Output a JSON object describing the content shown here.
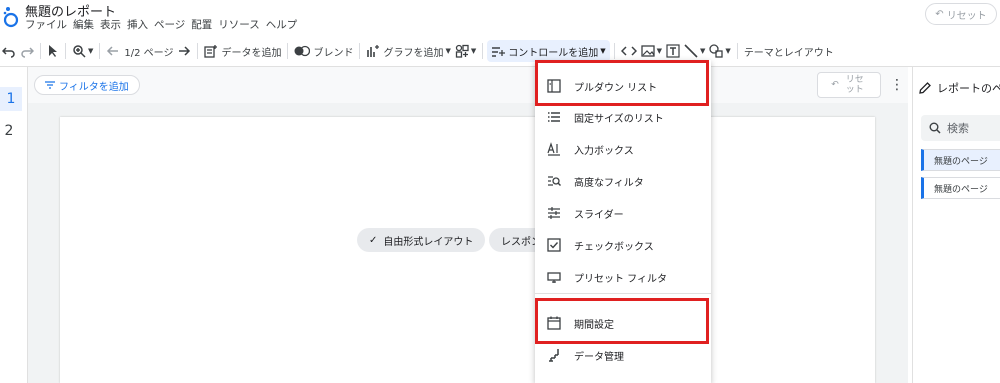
{
  "app": {
    "title": "無題のレポート",
    "menus": [
      "ファイル",
      "編集",
      "表示",
      "挿入",
      "ページ",
      "配置",
      "リソース",
      "ヘルプ"
    ],
    "reset_label": "リセット"
  },
  "toolbar": {
    "page_indicator": "1/2 ページ",
    "add_data": "データを追加",
    "blend": "ブレンド",
    "add_chart": "グラフを追加",
    "add_control": "コントロールを追加",
    "theme_layout": "テーマとレイアウト"
  },
  "pages_column": {
    "page1": "1",
    "page2": "2"
  },
  "canvas": {
    "add_filter": "フィルタを追加",
    "reset_label": "リセット",
    "chip_freeform": "自由形式レイアウト",
    "chip_responsive": "レスポンシブ レ"
  },
  "right_panel": {
    "title": "レポートのペ",
    "search": "検索",
    "pages": [
      "無題のページ",
      "無題のページ"
    ]
  },
  "control_menu": {
    "items": [
      {
        "label": "プルダウン リスト",
        "icon": "dropdown-list-icon"
      },
      {
        "label": "固定サイズのリスト",
        "icon": "fixed-list-icon"
      },
      {
        "label": "入力ボックス",
        "icon": "input-box-icon"
      },
      {
        "label": "高度なフィルタ",
        "icon": "advanced-filter-icon"
      },
      {
        "label": "スライダー",
        "icon": "slider-icon"
      },
      {
        "label": "チェックボックス",
        "icon": "checkbox-icon"
      },
      {
        "label": "プリセット フィルタ",
        "icon": "preset-filter-icon"
      },
      {
        "label": "期間設定",
        "icon": "calendar-icon"
      },
      {
        "label": "データ管理",
        "icon": "data-control-icon"
      }
    ]
  },
  "colors": {
    "accent": "#1a73e8",
    "highlight": "#e02020"
  }
}
